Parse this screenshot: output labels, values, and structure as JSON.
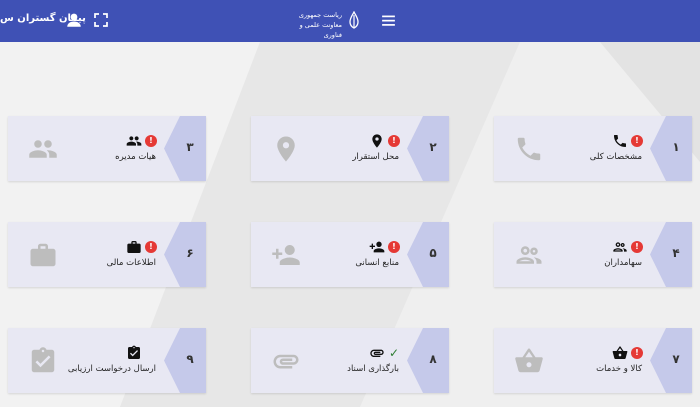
{
  "header": {
    "user_name": "پیمان گستران س",
    "org_line1": "ریاست جمهوری",
    "org_line2": "معاونت علمی و فناوری",
    "user_icon": "person-icon",
    "fullscreen_icon": "fullscreen-icon",
    "menu_icon": "hamburger-menu-icon",
    "emblem_icon": "iran-emblem-icon"
  },
  "colors": {
    "primary": "#3f51b5",
    "card_bg": "#e8e8f3",
    "number_tab": "#c5c9ea",
    "alert": "#e53935",
    "success": "#2e7d32",
    "icon_faded": "#bdbdbd"
  },
  "cards": [
    {
      "number": "۱",
      "title": "مشخصات کلی",
      "icon": "phone-icon",
      "status": "alert",
      "status_text": "!"
    },
    {
      "number": "۲",
      "title": "محل استقرار",
      "icon": "location-pin-icon",
      "status": "alert",
      "status_text": "!"
    },
    {
      "number": "۳",
      "title": "هیات مدیره",
      "icon": "people-icon",
      "status": "alert",
      "status_text": "!"
    },
    {
      "number": "۴",
      "title": "سهامداران",
      "icon": "shareholders-icon",
      "status": "alert",
      "status_text": "!"
    },
    {
      "number": "۵",
      "title": "منابع انسانی",
      "icon": "add-person-icon",
      "status": "alert",
      "status_text": "!"
    },
    {
      "number": "۶",
      "title": "اطلاعات مالی",
      "icon": "briefcase-icon",
      "status": "alert",
      "status_text": "!"
    },
    {
      "number": "۷",
      "title": "کالا و خدمات",
      "icon": "basket-icon",
      "status": "alert",
      "status_text": "!"
    },
    {
      "number": "۸",
      "title": "بارگذاری اسناد",
      "icon": "attachment-icon",
      "status": "done",
      "status_text": "✓"
    },
    {
      "number": "۹",
      "title": "ارسال درخواست ارزیابی",
      "icon": "clipboard-check-icon",
      "status": "none",
      "status_text": ""
    }
  ]
}
